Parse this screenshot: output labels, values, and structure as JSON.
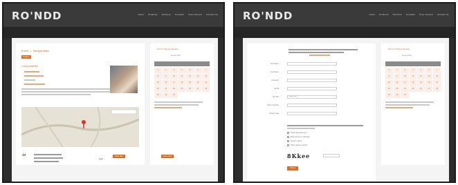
{
  "brand": {
    "logo": "RO'NDD",
    "accent": "#e36a1f",
    "dark": "#2d2d2d"
  },
  "left": {
    "nav": [
      "Home",
      "Products",
      "Services",
      "Contacts",
      "Free Content",
      "Contact Us"
    ],
    "event_title": "Event — Sample Date",
    "register_btn": "Register",
    "speaker_heading": "Local presenter",
    "cta_btn": "Book Now",
    "learn_btn": "Learn more",
    "quote_mark": "“",
    "quote_text": "Engaging the community.",
    "quote_text2": "Building the future of our region.",
    "quote_text3": "",
    "arrow": ">>",
    "calendar_title": "Find a Training Session",
    "calendar_month": "August 2011",
    "calendar_days": [
      "S",
      "M",
      "T",
      "W",
      "T",
      "F",
      "S"
    ],
    "calendar_dates": [
      "1",
      "2",
      "3",
      "4",
      "5",
      "6",
      "7",
      "8",
      "9",
      "10",
      "11",
      "12",
      "13",
      "14",
      "15",
      "16",
      "17",
      "18",
      "19",
      "20",
      "21",
      "22",
      "23",
      "24",
      "25",
      "26",
      "27",
      "28",
      "29",
      "30",
      "31"
    ]
  },
  "right": {
    "nav": [
      "Home",
      "Products",
      "Services",
      "Contacts",
      "Free Content",
      "Contact Us"
    ],
    "intro": "Please fill in the information below to join the training session.",
    "intro2": "Event — Sample Date",
    "form_labels": [
      "First Name",
      "Last Name",
      "Company",
      "Email",
      "Job Title",
      "Phone Number",
      "Postal Code"
    ],
    "select_placeholder": "Select one",
    "options_heading": "How did you hear about us?",
    "options": [
      "Online advertisement",
      "Referral from a colleague",
      "Search engine",
      "Other (please specify)"
    ],
    "captcha": "8Kkee",
    "submit_btn": "Submit",
    "calendar_title": "Find a Training Session",
    "calendar_month": "August 2011",
    "calendar_days": [
      "S",
      "M",
      "T",
      "W",
      "T",
      "F",
      "S"
    ],
    "calendar_dates": [
      "1",
      "2",
      "3",
      "4",
      "5",
      "6",
      "7",
      "8",
      "9",
      "10",
      "11",
      "12",
      "13",
      "14",
      "15",
      "16",
      "17",
      "18",
      "19",
      "20",
      "21",
      "22",
      "23",
      "24",
      "25",
      "26",
      "27",
      "28",
      "29",
      "30",
      "31"
    ]
  }
}
